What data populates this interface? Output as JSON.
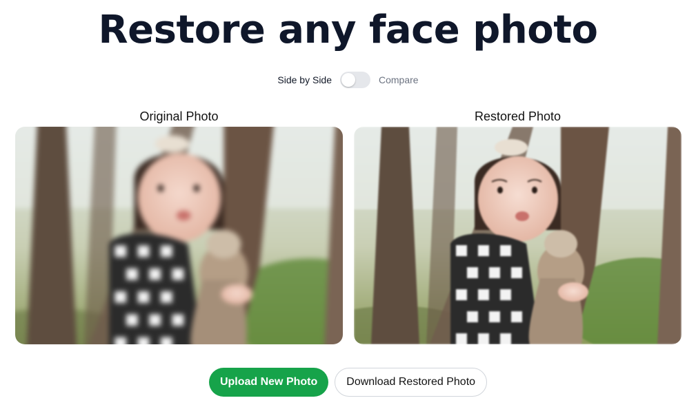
{
  "page": {
    "title": "Restore any face photo"
  },
  "view_toggle": {
    "left_label": "Side by Side",
    "right_label": "Compare",
    "state": "side-by-side"
  },
  "panels": [
    {
      "heading": "Original Photo",
      "image": "blurred photo of toddler holding plush toy under trees"
    },
    {
      "heading": "Restored Photo",
      "image": "restored photo of toddler holding plush toy under trees"
    }
  ],
  "actions": {
    "upload_label": "Upload New Photo",
    "download_label": "Download Restored Photo"
  },
  "colors": {
    "title": "#0f172a",
    "primary_button": "#16a34a",
    "toggle_track": "#e5e7eb"
  }
}
